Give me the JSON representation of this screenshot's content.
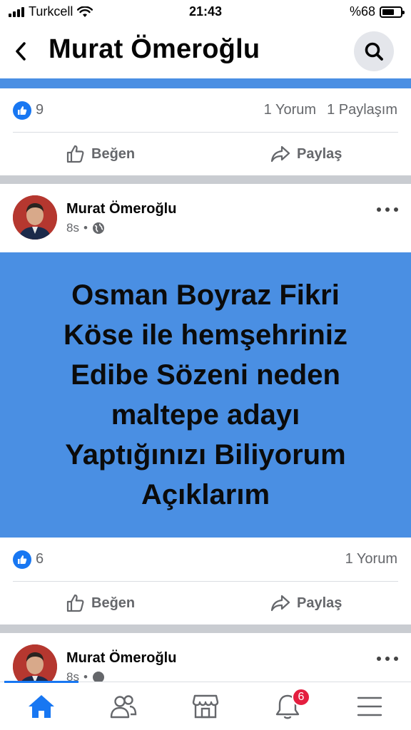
{
  "status_bar": {
    "carrier": "Turkcell",
    "time": "21:43",
    "battery": "%68",
    "battery_level": 0.68
  },
  "header": {
    "title": "Murat Ömeroğlu",
    "back_icon": "chevron-left-icon",
    "search_icon": "search-icon"
  },
  "previous_post": {
    "like_count": "9",
    "comments": "1 Yorum",
    "shares": "1 Paylaşım",
    "like_label": "Beğen",
    "share_label": "Paylaş"
  },
  "post": {
    "author": "Murat Ömeroğlu",
    "time": "8s",
    "separator": "•",
    "privacy_icon": "globe-icon",
    "image_lines": [
      "Osman Boyraz Fikri",
      "Köse ile hemşehriniz",
      "Edibe Sözeni neden",
      "maltepe adayı",
      "Yaptığınızı Biliyorum",
      "Açıklarım"
    ],
    "image_color": "#4a8fe3",
    "like_count": "6",
    "comments": "1 Yorum",
    "like_label": "Beğen",
    "share_label": "Paylaş"
  },
  "next_post": {
    "author": "Murat Ömeroğlu",
    "time": "8s",
    "separator": "•"
  },
  "tab_bar": {
    "active_color": "#1877f2",
    "notification_badge": "6",
    "tabs": [
      "home-icon",
      "friends-icon",
      "marketplace-icon",
      "bell-icon",
      "menu-icon"
    ]
  }
}
